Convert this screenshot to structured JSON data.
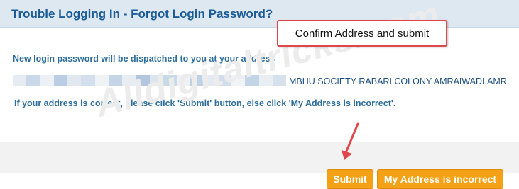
{
  "header": {
    "title": "Trouble Logging In - Forgot Login Password?"
  },
  "callout": {
    "text": "Confirm Address and submit"
  },
  "main": {
    "info": "New login password will be dispatched to you at your address",
    "address": "MBHU SOCIETY RABARI COLONY AMRAIWADI,AMR",
    "instruction": "If your address is correct, please click 'Submit' button, else click 'My Address is incorrect'."
  },
  "watermark": "Alldigitaltricks.com",
  "buttons": {
    "submit_label": "Submit",
    "incorrect_label": "My Address is incorrect"
  },
  "colors": {
    "header_bg": "#dde8f1",
    "title": "#1c5c96",
    "text": "#2e6e9c",
    "button": "#f5a115",
    "callout_border": "#e0474c",
    "arrow": "#e0474c"
  }
}
